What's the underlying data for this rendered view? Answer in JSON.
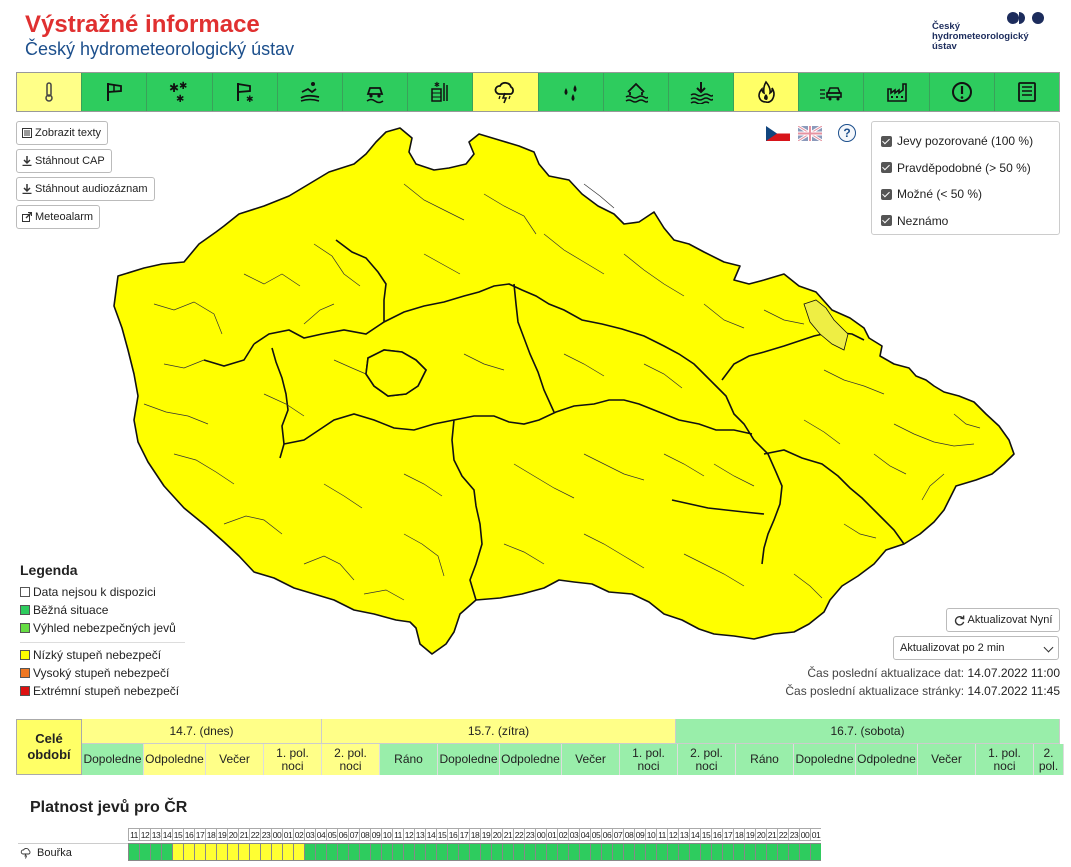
{
  "header": {
    "title": "Výstražné informace",
    "subtitle": "Český hydrometeorologický ústav"
  },
  "logo": {
    "text": "Český\nhydrometeorologický\nústav"
  },
  "icon_bar": [
    {
      "icon": "thermometer-icon",
      "state": "yellow"
    },
    {
      "icon": "wind-flag-icon",
      "state": "green"
    },
    {
      "icon": "snowflakes-icon",
      "state": "green"
    },
    {
      "icon": "windsock-snow-icon",
      "state": "green"
    },
    {
      "icon": "snow-drift-icon",
      "state": "green"
    },
    {
      "icon": "slippery-road-icon",
      "state": "green"
    },
    {
      "icon": "frost-icon",
      "state": "green"
    },
    {
      "icon": "thunderstorm-icon",
      "state": "yellow"
    },
    {
      "icon": "rain-drops-icon",
      "state": "green"
    },
    {
      "icon": "flood-house-icon",
      "state": "green"
    },
    {
      "icon": "water-level-icon",
      "state": "green"
    },
    {
      "icon": "fire-icon",
      "state": "yellow"
    },
    {
      "icon": "fog-car-icon",
      "state": "green"
    },
    {
      "icon": "smog-factory-icon",
      "state": "green"
    },
    {
      "icon": "exclamation-icon",
      "state": "green"
    },
    {
      "icon": "document-icon",
      "state": "green"
    }
  ],
  "left_buttons": {
    "show_texts": "Zobrazit texty",
    "download_cap": "Stáhnout CAP",
    "download_audio": "Stáhnout audiozáznam",
    "meteoalarm": "Meteoalarm"
  },
  "filters": [
    "Jevy pozorované (100 %)",
    "Pravděpodobné (> 50 %)",
    "Možné (< 50 %)",
    "Neznámo"
  ],
  "legend": {
    "title": "Legenda",
    "items": [
      {
        "label": "Data nejsou k dispozici",
        "color": "#ffffff"
      },
      {
        "label": "Běžná situace",
        "color": "#2ecc5e"
      },
      {
        "label": "Výhled nebezpečných jevů",
        "color": "#66dd44"
      },
      {
        "label": "Nízký stupeň nebezpečí",
        "color": "#ffff00"
      },
      {
        "label": "Vysoký stupeň nebezpečí",
        "color": "#ee7722"
      },
      {
        "label": "Extrémní stupeň nebezpečí",
        "color": "#dd1111"
      }
    ]
  },
  "update": {
    "now_button": "Aktualizovat Nyní",
    "interval": "Aktualizovat po 2 min",
    "data_label": "Čas poslední aktualizace dat:",
    "data_value": "14.07.2022 11:00",
    "page_label": "Čas poslední aktualizace stránky:",
    "page_value": "14.07.2022 11:45"
  },
  "periods": {
    "whole": "Celé období",
    "days": [
      {
        "label": "14.7. (dnes)",
        "color": "#ffff88"
      },
      {
        "label": "15.7. (zítra)",
        "color": "#ffff88"
      },
      {
        "label": "16.7. (sobota)",
        "color": "#99eeaa"
      }
    ],
    "parts": [
      {
        "label": "Dopoledne",
        "color": "#99eeaa"
      },
      {
        "label": "Odpoledne",
        "color": "#ffff88"
      },
      {
        "label": "Večer",
        "color": "#ffff88"
      },
      {
        "label": "1. pol. noci",
        "color": "#ffff88"
      },
      {
        "label": "2. pol. noci",
        "color": "#ffff88"
      },
      {
        "label": "Ráno",
        "color": "#99eeaa"
      },
      {
        "label": "Dopoledne",
        "color": "#99eeaa"
      },
      {
        "label": "Odpoledne",
        "color": "#99eeaa"
      },
      {
        "label": "Večer",
        "color": "#99eeaa"
      },
      {
        "label": "1. pol. noci",
        "color": "#99eeaa"
      },
      {
        "label": "2. pol. noci",
        "color": "#99eeaa"
      },
      {
        "label": "Ráno",
        "color": "#99eeaa"
      },
      {
        "label": "Dopoledne",
        "color": "#99eeaa"
      },
      {
        "label": "Odpoledne",
        "color": "#99eeaa"
      },
      {
        "label": "Večer",
        "color": "#99eeaa"
      },
      {
        "label": "1. pol. noci",
        "color": "#99eeaa"
      },
      {
        "label": "2. pol.",
        "color": "#99eeaa"
      }
    ]
  },
  "validity": {
    "title": "Platnost jevů pro ČR",
    "hours": [
      "11",
      "12",
      "13",
      "14",
      "15",
      "16",
      "17",
      "18",
      "19",
      "20",
      "21",
      "22",
      "23",
      "00",
      "01",
      "02",
      "03",
      "04",
      "05",
      "06",
      "07",
      "08",
      "09",
      "10",
      "11",
      "12",
      "13",
      "14",
      "15",
      "16",
      "17",
      "18",
      "19",
      "20",
      "21",
      "22",
      "23",
      "00",
      "01",
      "02",
      "03",
      "04",
      "05",
      "06",
      "07",
      "08",
      "09",
      "10",
      "11",
      "12",
      "13",
      "14",
      "15",
      "16",
      "17",
      "18",
      "19",
      "20",
      "21",
      "22",
      "23",
      "00",
      "01"
    ],
    "phenomenon": "Bouřka",
    "hour_levels": [
      "g",
      "g",
      "g",
      "g",
      "y",
      "y",
      "y",
      "y",
      "y",
      "y",
      "y",
      "y",
      "y",
      "y",
      "y",
      "y",
      "g",
      "g",
      "g",
      "g",
      "g",
      "g",
      "g",
      "g",
      "g",
      "g",
      "g",
      "g",
      "g",
      "g",
      "g",
      "g",
      "g",
      "g",
      "g",
      "g",
      "g",
      "g",
      "g",
      "g",
      "g",
      "g",
      "g",
      "g",
      "g",
      "g",
      "g",
      "g",
      "g",
      "g",
      "g",
      "g",
      "g",
      "g",
      "g",
      "g",
      "g",
      "g",
      "g",
      "g",
      "g",
      "g",
      "g"
    ]
  }
}
